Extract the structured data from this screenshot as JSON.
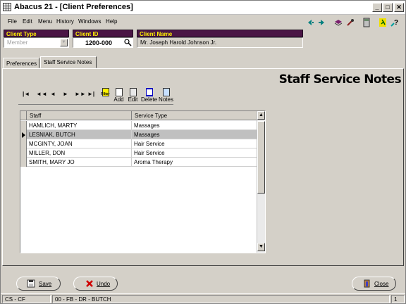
{
  "window": {
    "title": "Abacus 21 - [Client Preferences]"
  },
  "menu": [
    "File",
    "Edit",
    "Menu",
    "History",
    "Windows",
    "Help"
  ],
  "client": {
    "type_label": "Client Type",
    "type_value": "Member",
    "id_label": "Client ID",
    "id_value": "1200-000",
    "name_label": "Client Name",
    "name_value": "Mr. Joseph Harold Johnson Jr."
  },
  "tabs": [
    {
      "label": "Preferences"
    },
    {
      "label": "Staff Service Notes"
    }
  ],
  "panel": {
    "title": "Staff Service Notes"
  },
  "navigator": {
    "buttons": [
      "|◄",
      "◄◄",
      "◄",
      "►",
      "►►",
      "►|"
    ],
    "filter_label": "Filter",
    "add_label": "Add",
    "edit_label": "Edit",
    "delete_label": "Delete",
    "notes_label": "Notes"
  },
  "grid": {
    "columns": [
      "Staff",
      "Service Type"
    ],
    "rows": [
      {
        "staff": "HAMLICH, MARTY",
        "service": "Massages"
      },
      {
        "staff": "LESNIAK, BUTCH",
        "service": "Massages"
      },
      {
        "staff": "MCGINTY, JOAN",
        "service": "Hair Service"
      },
      {
        "staff": "MILLER, DON",
        "service": "Hair Service"
      },
      {
        "staff": "SMITH, MARY JO",
        "service": "Aroma Therapy"
      }
    ],
    "selected_row": 1
  },
  "buttons": {
    "save": "Save",
    "undo": "Undo",
    "close": "Close"
  },
  "status": {
    "left": "CS - CF",
    "middle": "00 - FB - DR - BUTCH",
    "right": "1"
  },
  "colors": {
    "label_bg": "#4a1545",
    "label_text": "#fff200"
  }
}
